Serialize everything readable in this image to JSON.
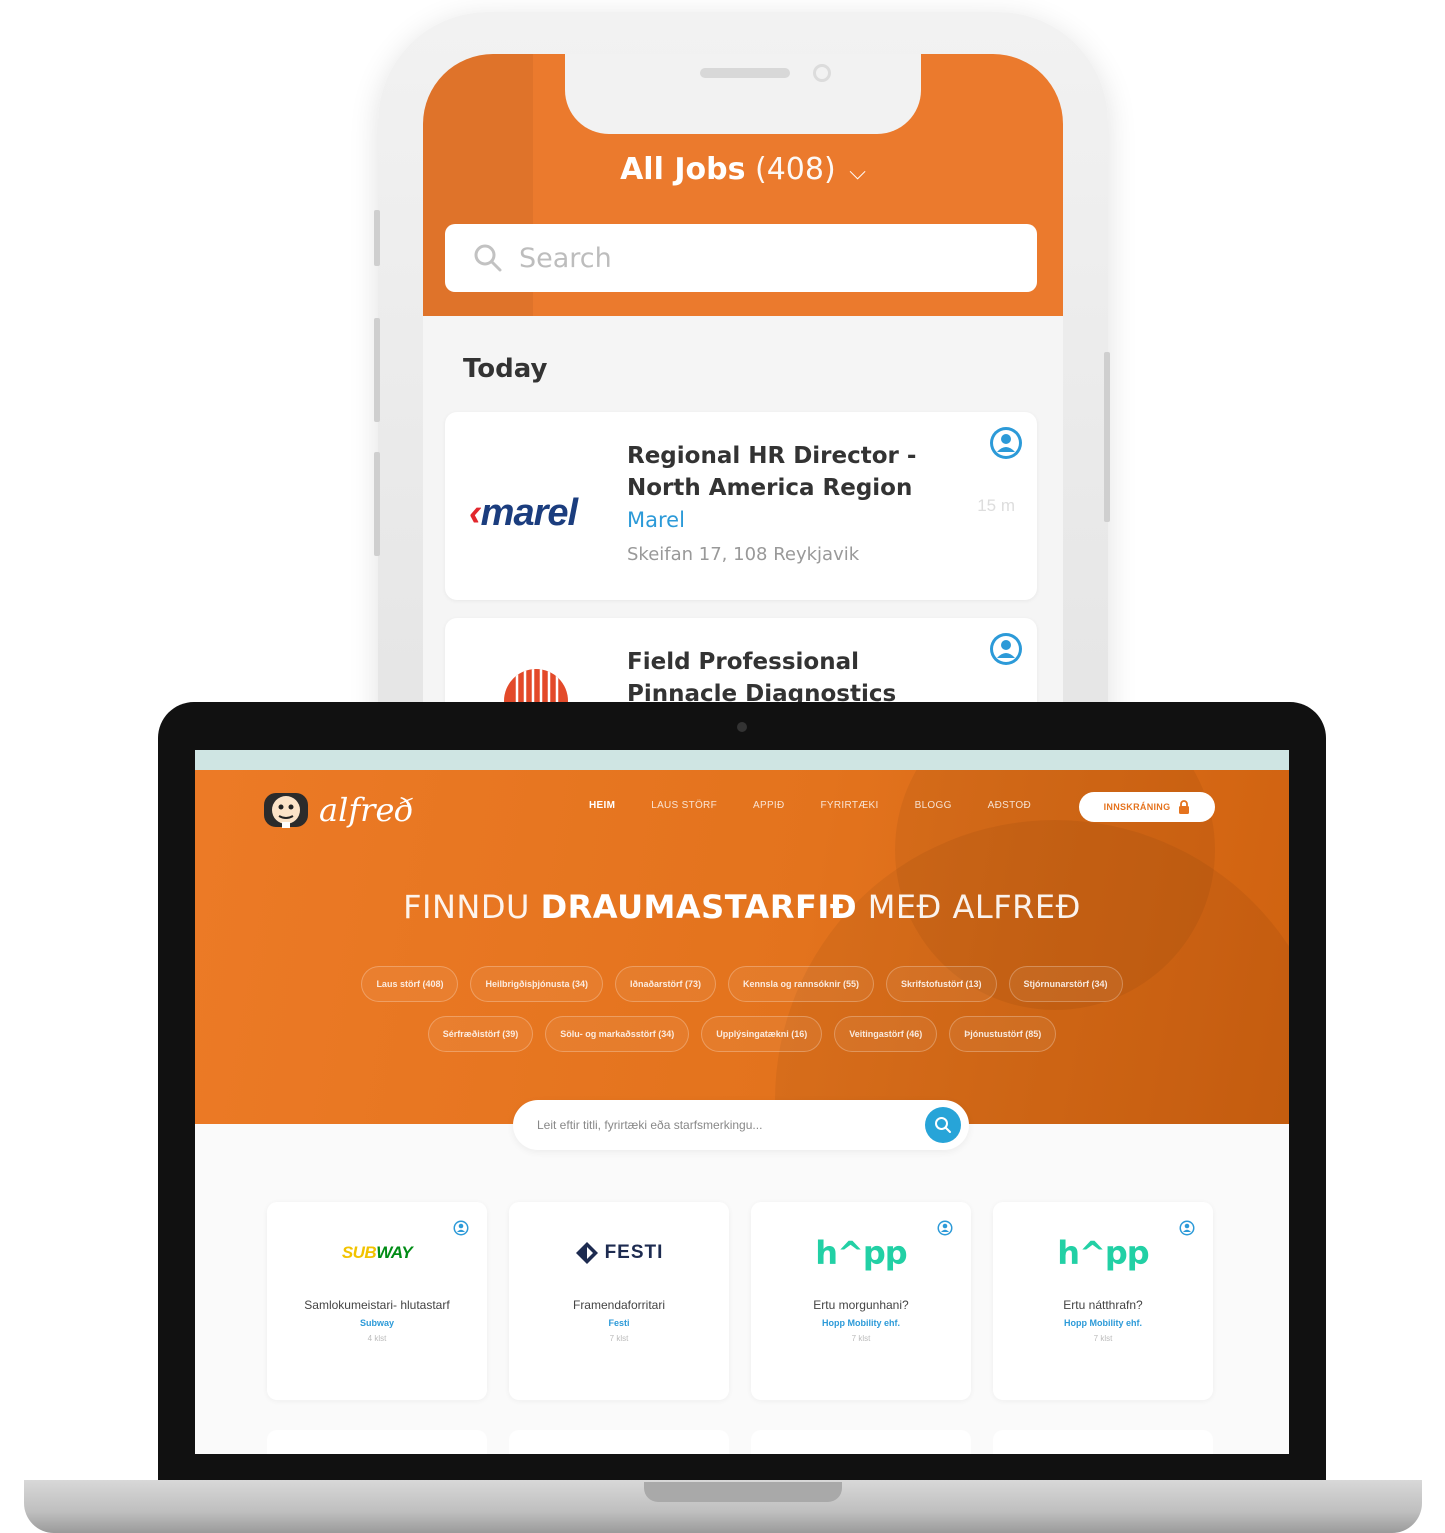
{
  "phone": {
    "header": {
      "title": "All Jobs",
      "count": "(408)",
      "dropdown_icon": "chevron-down-icon"
    },
    "search": {
      "placeholder": "Search",
      "icon": "search-icon"
    },
    "section_label": "Today",
    "jobs": [
      {
        "logo_text": "marel",
        "title": "Regional HR Director - North America Region",
        "company": "Marel",
        "location": "Skeifan 17, 108 Reykjavik",
        "time": "15 m"
      },
      {
        "title": "Field Professional Pinnacle Diagnostics"
      }
    ],
    "colors": {
      "header_bg": "#eb7a2d",
      "company_link": "#2c9ad8",
      "badge": "#2c9ad8"
    }
  },
  "website": {
    "logo_text": "alfreð",
    "nav": [
      "HEIM",
      "LAUS STÖRF",
      "APPIÐ",
      "FYRIRTÆKI",
      "BLOGG",
      "AÐSTOÐ"
    ],
    "login_label": "INNSKRÁNING",
    "hero_title": {
      "part1": "FINNDU ",
      "bold": "DRAUMASTARFIÐ",
      "part2": " MEÐ ALFREÐ"
    },
    "categories_row1": [
      "Laus störf (408)",
      "Heilbrigðisþjónusta (34)",
      "Iðnaðarstörf (73)",
      "Kennsla og rannsóknir (55)",
      "Skrifstofustörf (13)",
      "Stjórnunarstörf (34)"
    ],
    "categories_row2": [
      "Sérfræðistörf (39)",
      "Sölu- og markaðsstörf (34)",
      "Upplýsingatækni (16)",
      "Veitingastörf (46)",
      "Þjónustustörf (85)"
    ],
    "search_placeholder": "Leit eftir titli, fyrirtæki eða starfsmerkingu...",
    "jobs": [
      {
        "logo": "SUBWAY",
        "title": "Samlokumeistari- hlutastarf",
        "company": "Subway",
        "distance": "4 klst"
      },
      {
        "logo": "FESTI",
        "title": "Framendaforritari",
        "company": "Festi",
        "distance": "7 klst"
      },
      {
        "logo": "h^pp",
        "title": "Ertu morgunhani?",
        "company": "Hopp Mobility ehf.",
        "distance": "7 klst"
      },
      {
        "logo": "h^pp",
        "title": "Ertu nátthrafn?",
        "company": "Hopp Mobility ehf.",
        "distance": "7 klst"
      }
    ],
    "colors": {
      "hero_bg": "#e5731e",
      "search_button": "#27a4d8",
      "hopp_green": "#22d0a5"
    }
  }
}
